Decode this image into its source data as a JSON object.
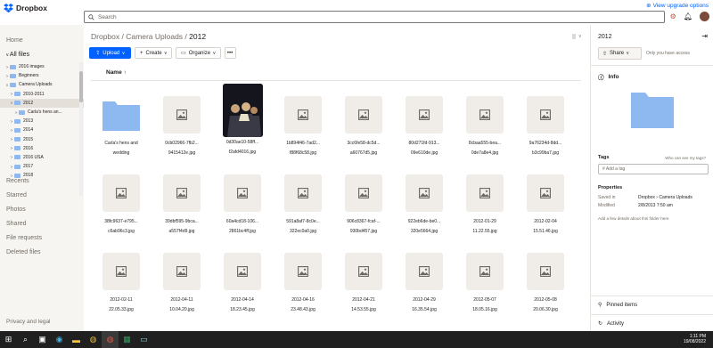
{
  "header": {
    "logo": "Dropbox",
    "upgrade": "View upgrade options",
    "search_placeholder": "Search"
  },
  "nav": {
    "home": "Home",
    "all_files": "All files",
    "recents": "Recents",
    "starred": "Starred",
    "photos": "Photos",
    "shared": "Shared",
    "file_requests": "File requests",
    "deleted_files": "Deleted files",
    "privacy": "Privacy and legal"
  },
  "tree": [
    {
      "label": "2016 images",
      "caret": ">",
      "indent": 1
    },
    {
      "label": "Beginners",
      "caret": ">",
      "indent": 1
    },
    {
      "label": "Camera Uploads",
      "caret": "v",
      "indent": 1
    },
    {
      "label": "2010-2011",
      "caret": ">",
      "indent": 2
    },
    {
      "label": "2012",
      "caret": "v",
      "indent": 2,
      "selected": true
    },
    {
      "label": "Carla's hens an...",
      "caret": ">",
      "indent": 3
    },
    {
      "label": "2013",
      "caret": ">",
      "indent": 2
    },
    {
      "label": "2014",
      "caret": ">",
      "indent": 2
    },
    {
      "label": "2015",
      "caret": ">",
      "indent": 2
    },
    {
      "label": "2016",
      "caret": ">",
      "indent": 2
    },
    {
      "label": "2016 USA",
      "caret": ">",
      "indent": 2
    },
    {
      "label": "2017",
      "caret": ">",
      "indent": 2
    },
    {
      "label": "2018",
      "caret": ">",
      "indent": 2
    }
  ],
  "breadcrumb": {
    "part1": "Dropbox",
    "part2": "Camera Uploads",
    "current": "2012",
    "sep": "/"
  },
  "toolbar": {
    "upload": "Upload",
    "create": "Create",
    "organize": "Organize",
    "more": "•••"
  },
  "columns": {
    "name": "Name",
    "sort_arrow": "↑"
  },
  "files": [
    {
      "l1": "Carla's hens and",
      "l2": "wedding",
      "kind": "folder"
    },
    {
      "l1": "0cb02966-7fb2...",
      "l2": "9415412e.jpg",
      "kind": "image"
    },
    {
      "l1": "0d30ae10-58ff...",
      "l2": "f2afd4016.jpg",
      "kind": "photo"
    },
    {
      "l1": "1b894f46-7ad2...",
      "l2": "f88f68c58.jpg",
      "kind": "image"
    },
    {
      "l1": "3cc6fe58-dc5d...",
      "l2": "a60767d5.jpg",
      "kind": "image"
    },
    {
      "l1": "80d271fd-913...",
      "l2": "09e610de.jpg",
      "kind": "image"
    },
    {
      "l1": "8cbaa555-bea...",
      "l2": "0de7a8e4.jpg",
      "kind": "image"
    },
    {
      "l1": "9a76234d-8dd...",
      "l2": "b3c99ba7.jpg",
      "kind": "image"
    },
    {
      "l1": "38fc9637-e795...",
      "l2": "c6ab96c3.jpg",
      "kind": "image"
    },
    {
      "l1": "39dbf595-9bca...",
      "l2": "a557f4d9.jpg",
      "kind": "image"
    },
    {
      "l1": "60a4cd18-106...",
      "l2": "2861bc4ff.jpg",
      "kind": "image"
    },
    {
      "l1": "591a8af7-8c0e...",
      "l2": "322ec0a0.jpg",
      "kind": "image"
    },
    {
      "l1": "906c8367-fcaf-...",
      "l2": "930bd457.jpg",
      "kind": "image"
    },
    {
      "l1": "922eb6de-be0...",
      "l2": "320e5664.jpg",
      "kind": "image"
    },
    {
      "l1": "2012-01-29",
      "l2": "11.22.55.jpg",
      "kind": "image"
    },
    {
      "l1": "2012-02-04",
      "l2": "15.51.46.jpg",
      "kind": "image"
    },
    {
      "l1": "2012-02-11",
      "l2": "22.05.33.jpg",
      "kind": "image"
    },
    {
      "l1": "2012-04-11",
      "l2": "10.04.20.jpg",
      "kind": "image"
    },
    {
      "l1": "2012-04-14",
      "l2": "18.23.45.jpg",
      "kind": "image"
    },
    {
      "l1": "2012-04-16",
      "l2": "23.48.43.jpg",
      "kind": "image"
    },
    {
      "l1": "2012-04-21",
      "l2": "14.53.55.jpg",
      "kind": "image"
    },
    {
      "l1": "2012-04-29",
      "l2": "16.35.54.jpg",
      "kind": "image"
    },
    {
      "l1": "2012-05-07",
      "l2": "18.05.16.jpg",
      "kind": "image"
    },
    {
      "l1": "2012-05-08",
      "l2": "20.06.30.jpg",
      "kind": "image"
    }
  ],
  "details": {
    "title": "2012",
    "share": "Share",
    "only_you": "Only you have access",
    "info": "Info",
    "tags": "Tags",
    "who_can_see": "Who can see my tags?",
    "add_tag": "# Add a tag",
    "properties": "Properties",
    "saved_in_label": "Saved in",
    "saved_in_value": "Dropbox  ›  Camera Uploads",
    "modified_label": "Modified",
    "modified_value": "2/8/2013 7:50 am",
    "add_details": "Add a few details about this folder here",
    "pinned": "Pinned items",
    "activity": "Activity"
  },
  "taskbar": {
    "time": "1:11 PM",
    "date": "19/08/2022"
  },
  "colors": {
    "accent": "#0061fe",
    "folder": "#8db8f0"
  }
}
